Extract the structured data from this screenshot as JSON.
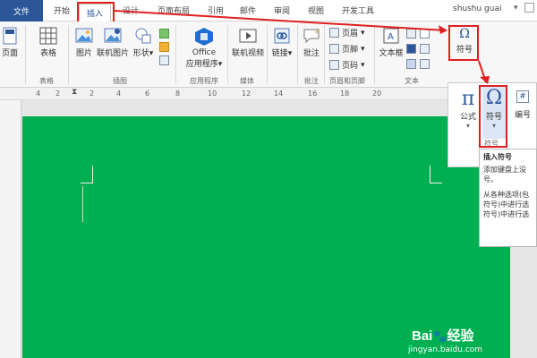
{
  "tabs": {
    "file": "文件",
    "home": "开始",
    "insert": "插入",
    "design": "设计",
    "layout": "页面布局",
    "references": "引用",
    "mailings": "邮件",
    "review": "审阅",
    "view": "视图",
    "developer": "开发工具"
  },
  "user": "shushu guai",
  "ribbon": {
    "cover_page": "页面",
    "table": "表格",
    "picture": "图片",
    "online_picture": "联机图片",
    "shapes": "形状",
    "office_apps_line1": "Office",
    "office_apps_line2": "应用程序",
    "online_video": "联机视频",
    "link": "链接",
    "comment": "批注",
    "header": "页眉",
    "footer": "页脚",
    "page_number": "页码",
    "text_box": "文本框",
    "symbol_top": "符号"
  },
  "groups": {
    "tables": "表格",
    "illustrations": "插图",
    "apps": "应用程序",
    "media": "媒体",
    "comments": "批注",
    "header_footer": "页眉和页脚",
    "text": "文本"
  },
  "ruler": {
    "marks": [
      "4",
      "2",
      "2",
      "4",
      "6",
      "8",
      "10",
      "12",
      "14",
      "16",
      "18",
      "20"
    ]
  },
  "popup": {
    "equation": "公式",
    "symbol": "符号",
    "numbering": "编号",
    "group_label": "符号"
  },
  "tooltip": {
    "title": "插入符号",
    "line1": "添加键盘上没",
    "line2": "号。",
    "line3": "从各种选项(包",
    "line4": "符号)中进行选",
    "line5": "符号)中进行选"
  },
  "watermark": {
    "logo": "Bai",
    "brand": "经验",
    "url": "jingyan.baidu.com"
  },
  "colors": {
    "accent": "#2b579a",
    "highlight": "#e02020",
    "page": "#00b050"
  },
  "icons": {
    "symbol": "omega",
    "equation": "pi"
  }
}
